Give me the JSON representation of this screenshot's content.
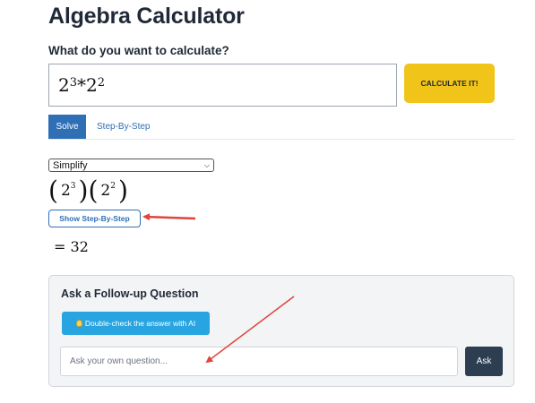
{
  "page": {
    "title": "Algebra Calculator",
    "question": "What do you want to calculate?"
  },
  "expression": {
    "base1": "2",
    "exp1": "3",
    "operator": "*",
    "base2": "2",
    "exp2": "2"
  },
  "calculate_button": "CALCULATE IT!",
  "tabs": [
    {
      "label": "Solve",
      "active": true
    },
    {
      "label": "Step-By-Step",
      "active": false
    }
  ],
  "mode_select": {
    "selected": "Simplify"
  },
  "rendered_math": {
    "left_base": "2",
    "left_exp": "3",
    "right_base": "2",
    "right_exp": "2"
  },
  "show_steps_button": "Show Step-By-Step",
  "result": "= 32",
  "followup": {
    "title": "Ask a Follow-up Question",
    "ai_button": "Double-check the answer with AI",
    "input_placeholder": "Ask your own question...",
    "ask_button": "Ask"
  },
  "colors": {
    "primary": "#2f6fb6",
    "calculate": "#f0c419",
    "ai_button": "#28a5e0",
    "ask_button": "#2c3e50",
    "annotation_arrow": "#e0443a"
  }
}
